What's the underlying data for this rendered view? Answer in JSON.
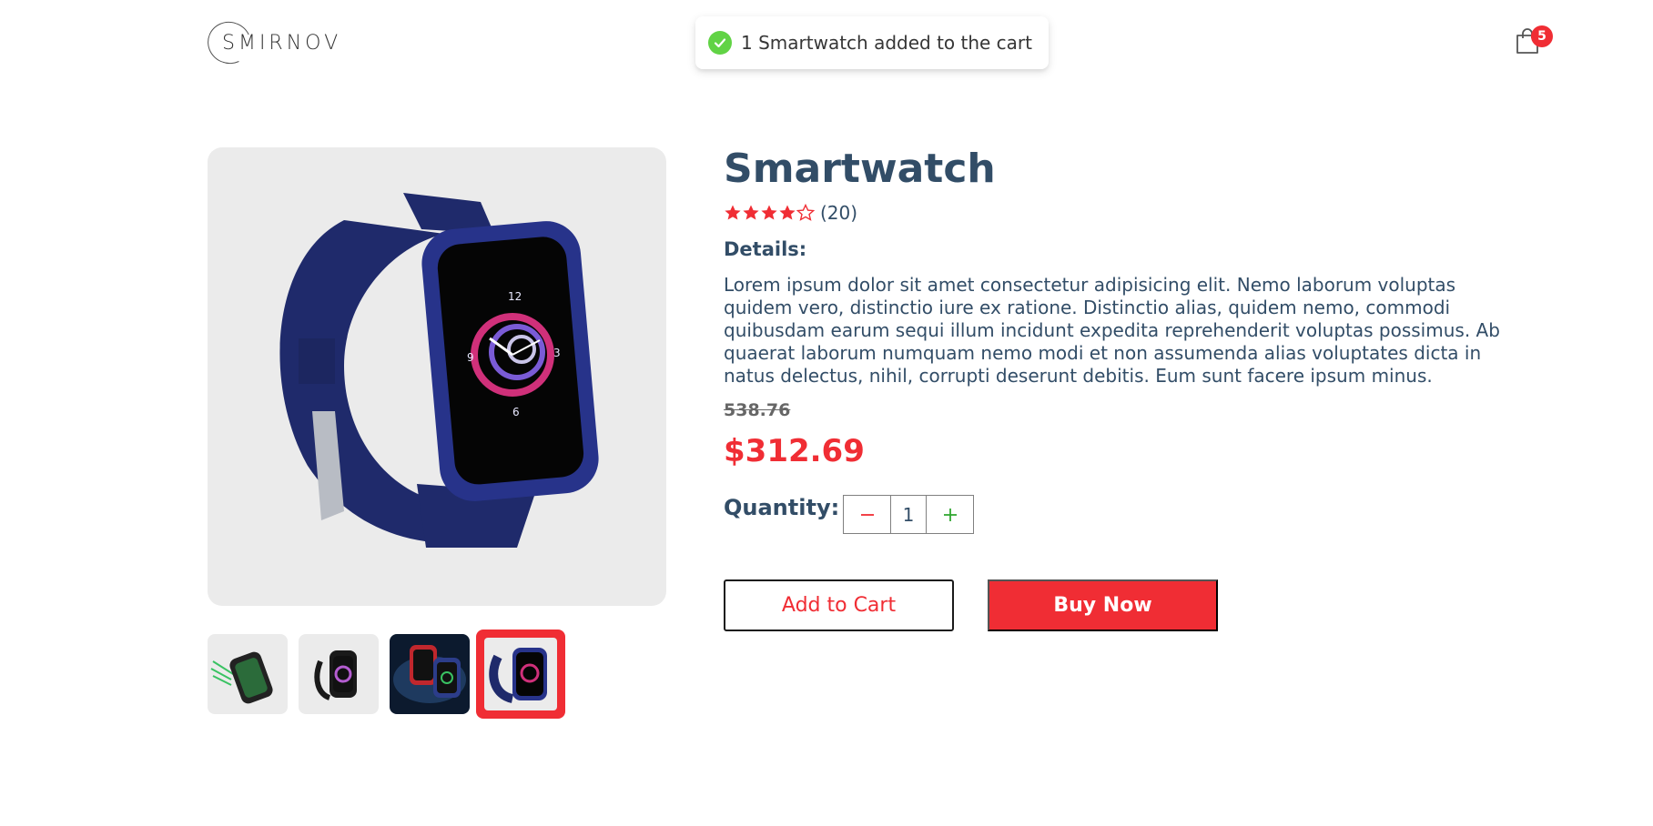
{
  "brand": {
    "logo_text": "SMIRNOV"
  },
  "toast": {
    "message": "1 Smartwatch added to the cart",
    "icon": "check-circle-icon",
    "color": "#61d345"
  },
  "cart": {
    "icon": "shopping-bag-icon",
    "count": "5"
  },
  "product": {
    "name": "Smartwatch",
    "rating": {
      "stars": 4,
      "max_stars": 5,
      "review_count": "(20)"
    },
    "details_label": "Details:",
    "description": "Lorem ipsum dolor sit amet consectetur adipisicing elit. Nemo laborum voluptas quidem vero, distinctio iure ex ratione. Distinctio alias, quidem nemo, commodi quibusdam earum sequi illum incidunt expedita reprehenderit voluptas possimus. Ab quaerat laborum numquam nemo modi et non assumenda alias voluptates dicta in natus delectus, nihil, corrupti deserunt debitis. Eum sunt facere ipsum minus.",
    "old_price": "538.76",
    "price": "$312.69",
    "images": [
      {
        "name": "thumbnail-green-smartwatch",
        "selected": false
      },
      {
        "name": "thumbnail-black-smartwatch",
        "selected": false
      },
      {
        "name": "thumbnail-red-smartwatch-set",
        "selected": false
      },
      {
        "name": "thumbnail-blue-smartwatch",
        "selected": true
      }
    ]
  },
  "quantity": {
    "label": "Quantity:",
    "value": "1",
    "minus_icon": "minus-icon",
    "plus_icon": "plus-icon"
  },
  "actions": {
    "add_to_cart": "Add to Cart",
    "buy_now": "Buy Now"
  },
  "colors": {
    "accent": "#f02d34",
    "text": "#324d67",
    "plus": "#31a831"
  }
}
